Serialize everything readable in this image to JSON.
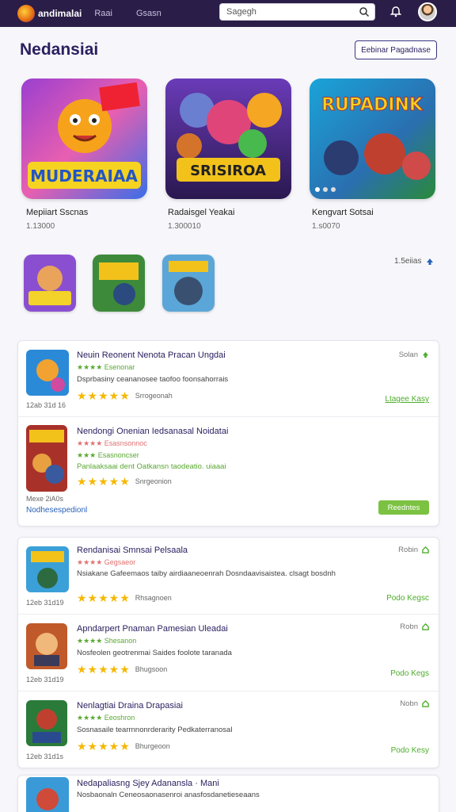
{
  "header": {
    "brand": "andimalai",
    "nav": [
      "Raai",
      "Gsasn"
    ],
    "search_placeholder": "Sagegh",
    "icons": [
      "search-icon",
      "bell-icon",
      "avatar"
    ]
  },
  "page": {
    "title": "Nedansiai",
    "action_label": "Eebinar Pagadnase"
  },
  "featured": [
    {
      "title": "Mepiiart Sscnas",
      "count": "1.13000",
      "art_text": "MUDERAIAA"
    },
    {
      "title": "Radaisgel Yeakai",
      "count": "1.300010",
      "art_text": "SRISIROA"
    },
    {
      "title": "Kengvart Sotsai",
      "count": "1.s0070",
      "art_text": "RUPADINK"
    }
  ],
  "sort": {
    "label": "1.5eiias"
  },
  "list1": [
    {
      "title": "Neuin Reonent Nenota Pracan Ungdai",
      "mini": "★★★★ Esenonar",
      "desc": "Dsprbasiny ceananosee taofoo foonsahorrais",
      "rating": 5,
      "rating_count": "Srrogeonah",
      "meta": "12ab 31d 16",
      "status": "Solan",
      "action": "Ltagee Kasy"
    },
    {
      "title": "Nendongi Onenian Iedsanasal Noidatai",
      "mini": "★★★★ Esasnsonnoc",
      "mini2": "★★★ Esasnoncser",
      "desc": "Panlaaksaai dent Oatkansn taodeatio. uiaaai",
      "rating": 5,
      "rating_count": "Snrgeonion",
      "meta": "Mexe 2iA0s",
      "meta2": "Nodhesespedionl",
      "action": "Reedntes"
    }
  ],
  "list2": [
    {
      "title": "Rendanisai Smnsai Pelsaala",
      "mini": "★★★★ Gegsaeor",
      "desc": "Nsiakane Gafeemaos taiby airdiaaneoenrah Dosndaavisaistea. clsagt bosdnh",
      "rating": 5,
      "rating_count": "Rhsagnoen",
      "meta": "12eb 31d19",
      "status": "Robin",
      "action": "Podo Kegsc"
    },
    {
      "title": "Apndarpert Pnaman Pamesian Uleadai",
      "mini": "★★★★ Shesanon",
      "desc": "Nosfeolen geotrenmai Saides foolote taranada",
      "rating": 5,
      "rating_count": "Bhugsoon",
      "meta": "12eb 31d19",
      "status": "Robn",
      "action": "Podo Kegs"
    },
    {
      "title": "Nenlagtiai Draina Drapasiai",
      "mini": "★★★★ Eeoshron",
      "desc": "Sosnasaile tearrnnonrderarity Pedkaterranosal",
      "rating": 5,
      "rating_count": "Bhurgeoon",
      "meta": "12eb 31d1s",
      "status": "Nobn",
      "action": "Podo Kesy"
    },
    {
      "title": "Nedapaliasng Sjey Adanansla · Mani",
      "desc": "Nosbaonaln Ceneosaonasenroi anasfosdanetieseaans"
    }
  ],
  "colors": {
    "header_bg": "#2a1d47",
    "title": "#2b2160",
    "star": "#f5b800",
    "green": "#5aa832"
  }
}
